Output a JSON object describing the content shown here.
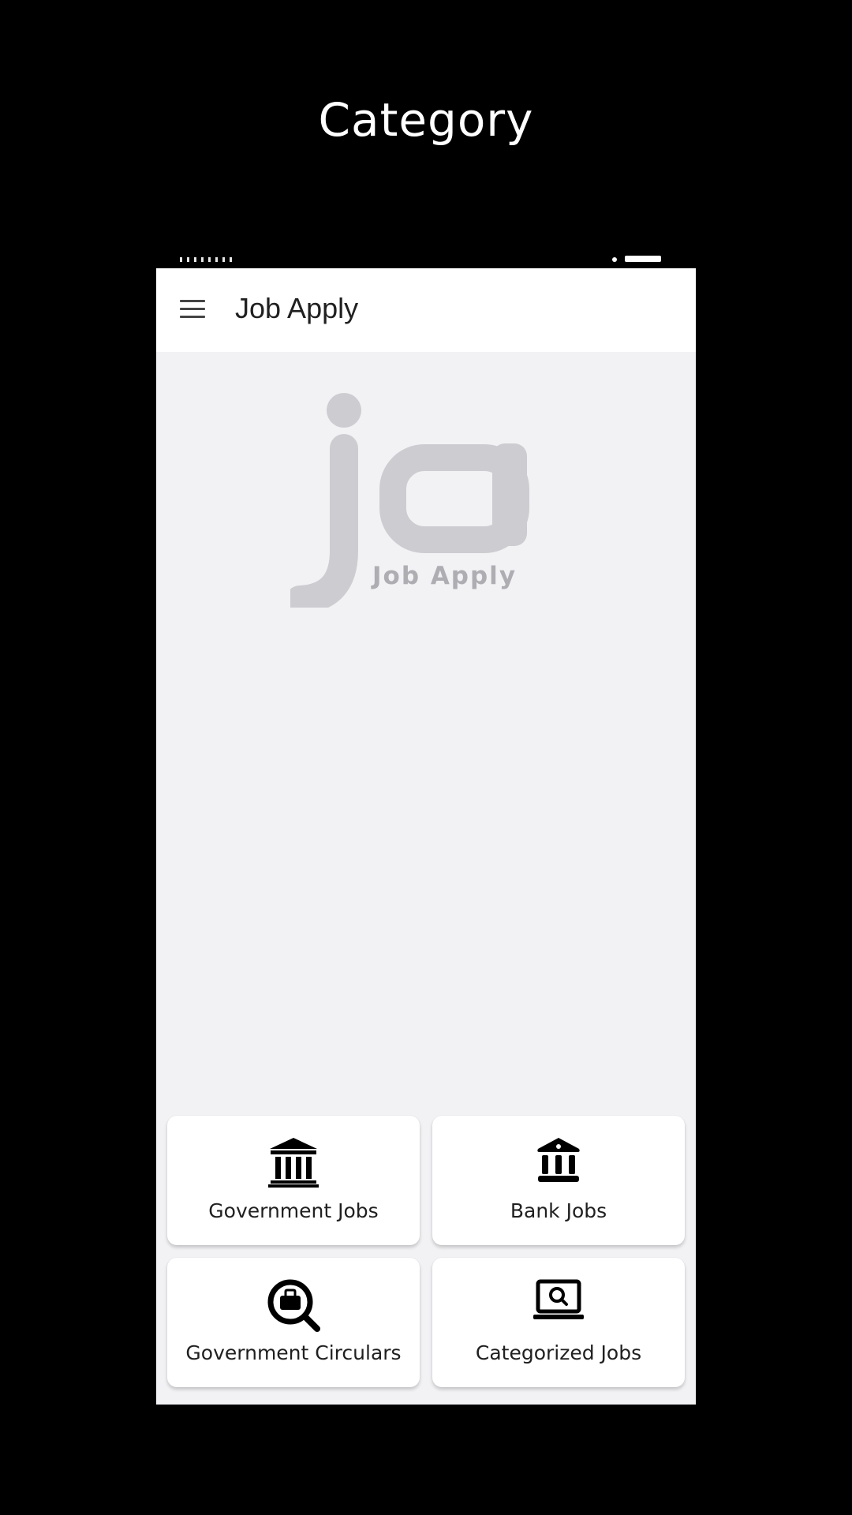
{
  "promo": {
    "title": "Category"
  },
  "appbar": {
    "title": "Job Apply",
    "menu_icon": "hamburger-menu-icon"
  },
  "logo": {
    "letters": "ja",
    "wordmark": "Job Apply",
    "color": "#cdccd0"
  },
  "categories": [
    {
      "label": "Government Jobs",
      "icon": "government-building-icon"
    },
    {
      "label": "Bank Jobs",
      "icon": "bank-icon"
    },
    {
      "label": "Government Circulars",
      "icon": "job-search-icon"
    },
    {
      "label": "Categorized Jobs",
      "icon": "laptop-search-icon"
    }
  ],
  "colors": {
    "background": "#000000",
    "screen": "#f2f1f4",
    "card": "#ffffff",
    "text": "#202020"
  }
}
